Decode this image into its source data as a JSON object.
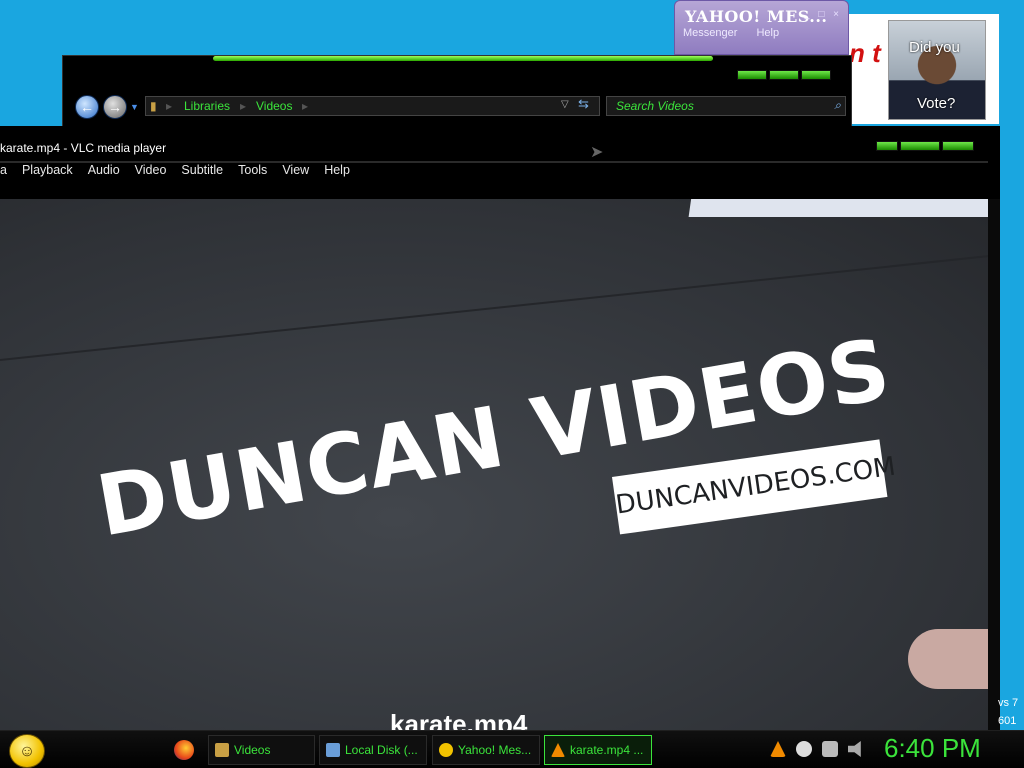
{
  "yahoo": {
    "logo": "YAHOO! MES...",
    "menu": [
      "Messenger",
      "Help"
    ],
    "controls": "_ □ ×"
  },
  "ad": {
    "partial_red_text": "n t",
    "text_line1": "Did you",
    "text_line2": "Vote?"
  },
  "explorer": {
    "breadcrumb": [
      "Libraries",
      "Videos"
    ],
    "search_placeholder": "Search Videos"
  },
  "vlc": {
    "title": "karate.mp4 - VLC media player",
    "menu": [
      "a",
      "Playback",
      "Audio",
      "Video",
      "Subtitle",
      "Tools",
      "View",
      "Help"
    ],
    "video_title": "DUNCAN VIDEOS",
    "video_url": "DUNCANVIDEOS.COM",
    "subtitle": "karate.mp4"
  },
  "win7_badge": [
    "vs 7",
    "601"
  ],
  "taskbar": {
    "items": [
      {
        "label": "Videos",
        "icon": "folder-icon",
        "color": "#c8a045"
      },
      {
        "label": "Local Disk (...",
        "icon": "drive-icon",
        "color": "#6a9ed8"
      },
      {
        "label": "Yahoo! Mes...",
        "icon": "yahoo-smiley-icon",
        "color": "#f2c200"
      },
      {
        "label": "karate.mp4 ...",
        "icon": "vlc-cone-icon",
        "color": "#f08a00"
      }
    ],
    "clock": "6:40 PM"
  },
  "colors": {
    "accent_green": "#3be43b",
    "desktop": "#1aa6e0"
  }
}
